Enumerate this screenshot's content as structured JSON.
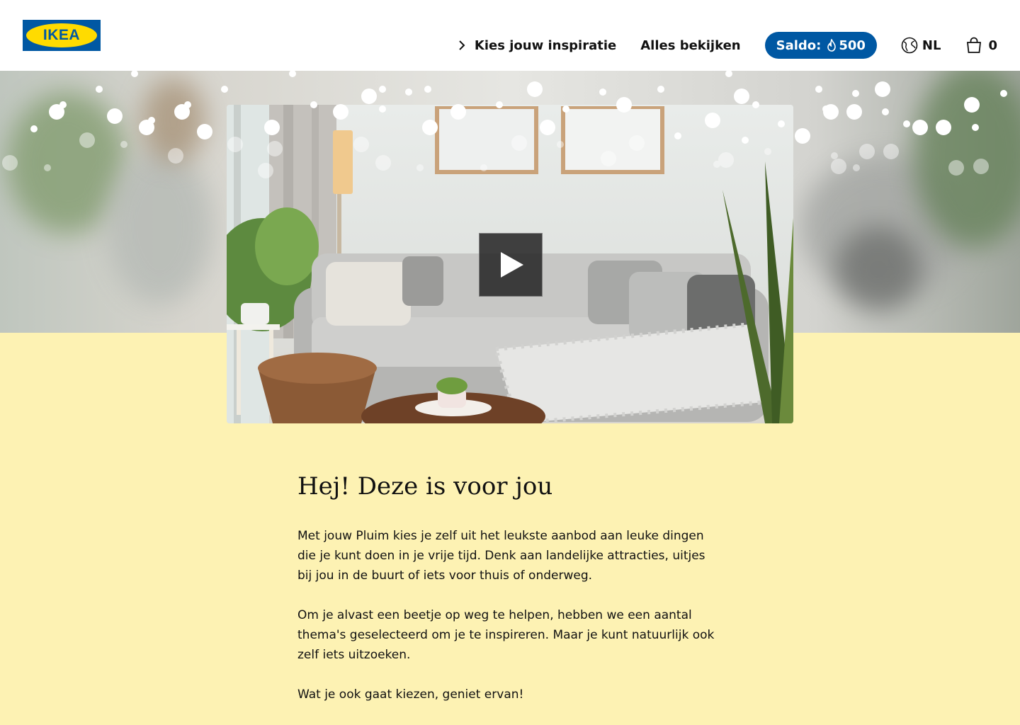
{
  "header": {
    "logo_text": "IKEA",
    "nav": {
      "inspiratie_label": "Kies jouw inspiratie",
      "alles_label": "Alles bekijken"
    },
    "saldo": {
      "label": "Saldo:",
      "amount": "500",
      "icon": "flame-icon",
      "background": "#0058a3"
    },
    "language": {
      "label": "NL",
      "icon": "globe-icon"
    },
    "cart": {
      "count": "0",
      "icon": "shopping-bag-icon"
    }
  },
  "hero": {
    "video": {
      "icon": "play-icon"
    }
  },
  "content": {
    "heading": "Hej! Deze is voor jou",
    "paragraphs": [
      "Met jouw Pluim kies je zelf uit het leukste aanbod aan leuke dingen die je kunt doen in je vrije tijd. Denk aan landelijke attracties, uitjes bij jou in de buurt of iets voor thuis of onderweg.",
      "Om je alvast een beetje op weg te helpen, hebben we een aantal thema's geselecteerd om je te inspireren. Maar je kunt natuurlijk ook zelf iets uitzoeken.",
      "Wat je ook gaat kiezen, geniet ervan!"
    ]
  },
  "colors": {
    "brand_blue": "#0058a3",
    "brand_yellow": "#ffdb00",
    "page_background": "#fdf2b3"
  }
}
